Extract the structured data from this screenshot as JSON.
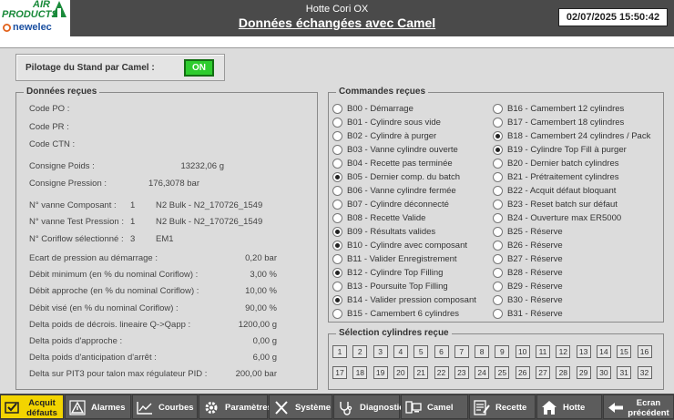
{
  "header": {
    "logo_text_top": "AIR",
    "logo_text_mid": "PRODUCTS",
    "logo_text_bottom": "newelec",
    "machine": "Hotte Cori OX",
    "title": "Données échangées avec Camel",
    "datetime": "02/07/2025 15:50:42"
  },
  "pilot": {
    "label": "Pilotage du Stand par Camel :",
    "state": "ON",
    "color": "#2ecc2e"
  },
  "data_received": {
    "title": "Données reçues",
    "code_po": "Code PO :",
    "code_pr": "Code PR :",
    "code_ctn": "Code CTN :",
    "consigne_poids_label": "Consigne Poids :",
    "consigne_poids_value": "13232,06 g",
    "consigne_pression_label": "Consigne Pression :",
    "consigne_pression_value": "176,3078 bar",
    "vanne_comp_label": "N° vanne Composant :",
    "vanne_comp_num": "1",
    "vanne_comp_name": "N2 Bulk - N2_170726_1549",
    "vanne_test_label": "N° vanne Test Pression :",
    "vanne_test_num": "1",
    "vanne_test_name": "N2 Bulk - N2_170726_1549",
    "coriflow_label": "N° Coriflow sélectionné :",
    "coriflow_num": "3",
    "coriflow_name": "EM1",
    "params": [
      {
        "label": "Ecart de pression au démarrage :",
        "value": "0,20 bar"
      },
      {
        "label": "Débit minimum (en % du nominal Coriflow) :",
        "value": "3,00 %"
      },
      {
        "label": "Débit approche (en % du nominal Coriflow) :",
        "value": "10,00 %"
      },
      {
        "label": "Débit visé (en % du nominal Coriflow) :",
        "value": "90,00 %"
      },
      {
        "label": "Delta poids de décrois. lineaire Q->Qapp :",
        "value": "1200,00 g"
      },
      {
        "label": "Delta poids d'approche :",
        "value": "0,00 g"
      },
      {
        "label": "Delta poids d'anticipation d'arrêt :",
        "value": "6,00 g"
      },
      {
        "label": "Delta sur PIT3 pour talon max régulateur PID :",
        "value": "200,00 bar"
      }
    ]
  },
  "commands": {
    "title": "Commandes reçues",
    "left": [
      {
        "label": "B00 - Démarrage",
        "on": false
      },
      {
        "label": "B01 - Cylindre sous vide",
        "on": false
      },
      {
        "label": "B02 - Cylindre à purger",
        "on": false
      },
      {
        "label": "B03 - Vanne cylindre ouverte",
        "on": false
      },
      {
        "label": "B04 - Recette pas terminée",
        "on": false
      },
      {
        "label": "B05 - Dernier comp. du batch",
        "on": true
      },
      {
        "label": "B06 - Vanne cylindre fermée",
        "on": false
      },
      {
        "label": "B07 - Cylindre déconnecté",
        "on": false
      },
      {
        "label": "B08 - Recette Valide",
        "on": false
      },
      {
        "label": "B09 - Résultats valides",
        "on": true
      },
      {
        "label": "B10 - Cylindre avec composant",
        "on": true
      },
      {
        "label": "B11 - Valider Enregistrement",
        "on": false
      },
      {
        "label": "B12 - Cylindre Top Filling",
        "on": true
      },
      {
        "label": "B13 - Poursuite Top Filling",
        "on": false
      },
      {
        "label": "B14 - Valider pression composant",
        "on": true
      },
      {
        "label": "B15 - Camembert 6 cylindres",
        "on": false
      }
    ],
    "right": [
      {
        "label": "B16 - Camembert 12 cylindres",
        "on": false
      },
      {
        "label": "B17 - Camembert 18 cylindres",
        "on": false
      },
      {
        "label": "B18 - Camembert 24 cylindres / Pack",
        "on": true
      },
      {
        "label": "B19 - Cylindre Top Fill à purger",
        "on": true
      },
      {
        "label": "B20 - Dernier batch cylindres",
        "on": false
      },
      {
        "label": "B21 - Prétraitement cylindres",
        "on": false
      },
      {
        "label": "B22 - Acquit défaut bloquant",
        "on": false
      },
      {
        "label": "B23 - Reset batch sur défaut",
        "on": false
      },
      {
        "label": "B24 - Ouverture max ER5000",
        "on": false
      },
      {
        "label": "B25 - Réserve",
        "on": false
      },
      {
        "label": "B26 - Réserve",
        "on": false
      },
      {
        "label": "B27 - Réserve",
        "on": false
      },
      {
        "label": "B28 - Réserve",
        "on": false
      },
      {
        "label": "B29 - Réserve",
        "on": false
      },
      {
        "label": "B30 - Réserve",
        "on": false
      },
      {
        "label": "B31 - Réserve",
        "on": false
      }
    ]
  },
  "selection": {
    "title": "Sélection cylindres reçue",
    "cylinders": [
      "1",
      "2",
      "3",
      "4",
      "5",
      "6",
      "7",
      "8",
      "9",
      "10",
      "11",
      "12",
      "13",
      "14",
      "15",
      "16",
      "17",
      "18",
      "19",
      "20",
      "21",
      "22",
      "23",
      "24",
      "25",
      "26",
      "27",
      "28",
      "29",
      "30",
      "31",
      "32"
    ]
  },
  "nav": [
    {
      "label": "Acquit",
      "label2": "défauts",
      "icon": "acknowledge-icon",
      "active": true
    },
    {
      "label": "Alarmes",
      "icon": "warning-icon",
      "active": false
    },
    {
      "label": "Courbes",
      "icon": "chart-icon",
      "active": false
    },
    {
      "label": "Paramètres",
      "icon": "gear-icon",
      "active": false
    },
    {
      "label": "Système",
      "icon": "tools-icon",
      "active": false
    },
    {
      "label": "Diagnostic",
      "icon": "stethoscope-icon",
      "active": false
    },
    {
      "label": "Camel",
      "icon": "computer-icon",
      "active": false
    },
    {
      "label": "Recette",
      "icon": "recipe-icon",
      "active": false
    },
    {
      "label": "Hotte",
      "icon": "home-icon",
      "active": false
    },
    {
      "label": "Ecran",
      "label2": "précédent",
      "icon": "back-arrow-icon",
      "active": false
    }
  ]
}
